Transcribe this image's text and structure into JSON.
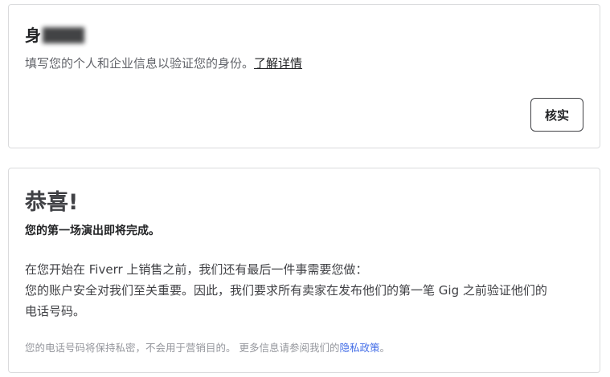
{
  "identity_card": {
    "title": "身份验证",
    "description": "填写您的个人和企业信息以验证您的身份。",
    "learn_more": "了解详情",
    "verify_button": "核实"
  },
  "phone_card": {
    "heading": "恭喜!",
    "subheading": "您的第一场演出即将完成。",
    "paragraph_line1": "在您开始在 Fiverr 上销售之前，我们还有最后一件事需要您做：",
    "paragraph_line2": "您的账户安全对我们至关重要。因此，我们要求所有卖家在发布他们的第一笔 Gig 之前验证他们的",
    "paragraph_line3": "电话号码。",
    "privacy_note": "您的电话号码将保持私密，不会用于营销目的。 更多信息请参阅我们的",
    "privacy_link": "隐私政策",
    "privacy_end": "。"
  },
  "colors": {
    "link_blue": "#446ee7",
    "text_dark": "#222325",
    "text_muted": "#62646a",
    "border": "#dadbdd"
  }
}
